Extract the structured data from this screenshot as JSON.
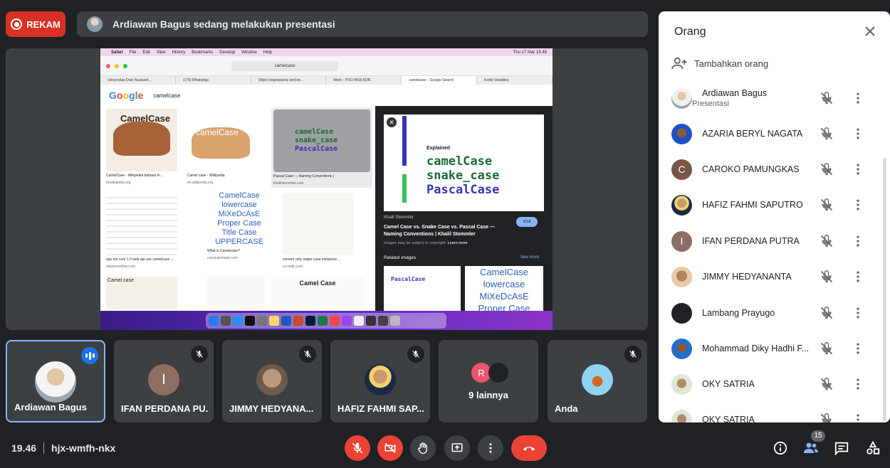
{
  "record": {
    "label": "REKAM"
  },
  "presenting": {
    "text": "Ardiawan Bagus sedang melakukan presentasi"
  },
  "shared_screen": {
    "menubar": [
      "Safari",
      "File",
      "Edit",
      "View",
      "History",
      "Bookmarks",
      "Develop",
      "Window",
      "Help"
    ],
    "clock": "Thu 17 Mar 19.46",
    "url": "camelcase",
    "tabs": [
      "Universitas Dian Nuswant...",
      "(179) WhatsApp",
      "Object expressions and de...",
      "Meet – PSO 4416-KDR",
      "camelcase – Google Search",
      "Kotlin Variables"
    ],
    "google_logo": "Google",
    "search_text": "camelcase",
    "results": [
      {
        "title": "CamelCase - Wikipedia bahasa In...",
        "source": "id.wikipedia.org"
      },
      {
        "title": "Camel case - Wikipedia",
        "source": "en.wikipedia.org"
      },
      {
        "title": "Pascal Case — Naming Conventions |",
        "source": "khalilstemmler.com"
      },
      {
        "title": "asp.net core 1.0 web api use camelcase ...",
        "source": "stackoverflow.com"
      },
      {
        "title": "What is Camelcase?",
        "source": "computerhope.com"
      },
      {
        "title": "convert only snake case instances ...",
        "source": "co-radic.com"
      }
    ],
    "thumb_texts": {
      "camel1": "CamelCase",
      "camel2": "camelCase",
      "cases": [
        "CamelCase",
        "lowercase",
        "MiXeDcAsE",
        "Proper Case",
        "Title Case",
        "UPPERCASE"
      ],
      "row3a": "Camel case",
      "row3c": "Camel Case"
    },
    "panel": {
      "explained": "Explained",
      "words": [
        "camelCase",
        "snake_case",
        "PascalCase"
      ],
      "source": "Khalil Stemmler",
      "title": "Camel Case vs. Snake Case vs. Pascal Case — Naming Conventions | Khalil Stemmler",
      "visit": "Visit",
      "copyright": "Images may be subject to copyright.",
      "learn_more": "Learn more",
      "related": "Related images",
      "see_more": "See more",
      "related_a": "PascalCase",
      "related_b": [
        "CamelCase",
        "lowercase",
        "MiXeDcAsE",
        "Proper Case"
      ]
    }
  },
  "tiles": [
    {
      "name": "Ardiawan Bagus",
      "initial": ""
    },
    {
      "name": "IFAN PERDANA PU...",
      "initial": "I"
    },
    {
      "name": "JIMMY HEDYANA...",
      "initial": ""
    },
    {
      "name": "HAFIZ FAHMI SAP...",
      "initial": ""
    },
    {
      "name": "9 lainnya",
      "initial": "R"
    },
    {
      "name": "Anda",
      "initial": ""
    }
  ],
  "bottom": {
    "time": "19.46",
    "code": "hjx-wmfh-nkx"
  },
  "people_panel": {
    "title": "Orang",
    "add_label": "Tambahkan orang",
    "participant_count": "15",
    "participants": [
      {
        "name": "Ardiawan Bagus",
        "sub": "Presentasi",
        "initial": ""
      },
      {
        "name": "AZARIA BERYL NAGATA",
        "sub": "",
        "initial": ""
      },
      {
        "name": "CAROKO PAMUNGKAS",
        "sub": "",
        "initial": "C"
      },
      {
        "name": "HAFIZ FAHMI SAPUTRO",
        "sub": "",
        "initial": ""
      },
      {
        "name": "IFAN PERDANA PUTRA",
        "sub": "",
        "initial": "I"
      },
      {
        "name": "JIMMY HEDYANANTA",
        "sub": "",
        "initial": ""
      },
      {
        "name": "Lambang Prayugo",
        "sub": "",
        "initial": ""
      },
      {
        "name": "Mohammad Diky Hadhi F...",
        "sub": "",
        "initial": ""
      },
      {
        "name": "OKY SATRIA",
        "sub": "",
        "initial": ""
      },
      {
        "name": "OKY SATRIA",
        "sub": "",
        "initial": ""
      }
    ]
  },
  "colors": {
    "accent": "#1a73e8",
    "danger": "#ea4335",
    "record": "#d93025",
    "background": "#202124",
    "surface": "#3c4043"
  }
}
